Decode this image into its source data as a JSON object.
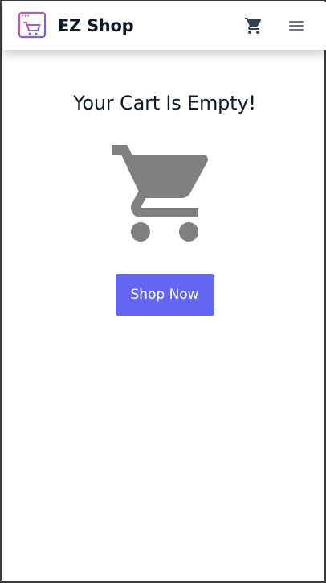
{
  "navbar": {
    "brand_name": "EZ Shop",
    "logo_icon": "shop-logo-icon",
    "cart_icon": "cart-icon",
    "menu_icon": "hamburger-menu-icon"
  },
  "main": {
    "title": "Your Cart Is Empty!",
    "illustration_icon": "empty-cart-icon",
    "shop_now_label": "Shop Now"
  },
  "colors": {
    "accent": "#6366f1",
    "icon_gray": "#808080",
    "text_dark": "#111827"
  }
}
